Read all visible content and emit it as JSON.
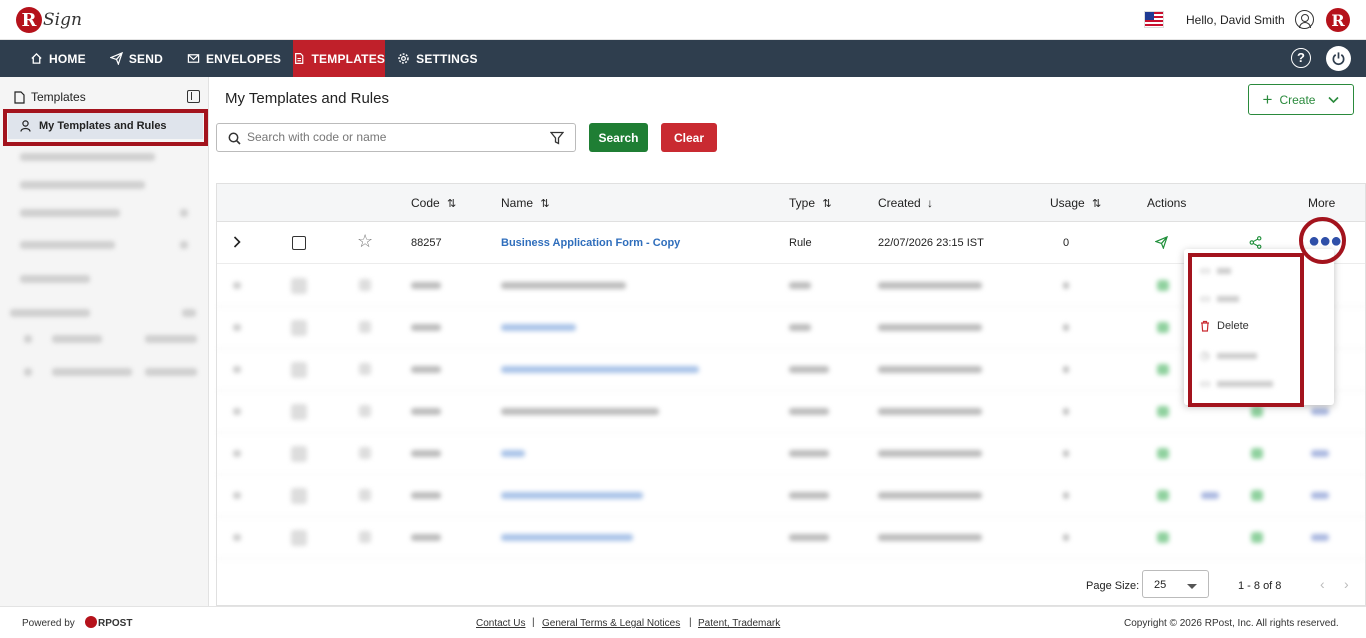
{
  "app": {
    "logo_letter": "R",
    "logo_text": "Sign"
  },
  "header": {
    "greeting": "Hello, David Smith",
    "avatar_letter": "R"
  },
  "nav": {
    "items": [
      {
        "label": "HOME",
        "icon": "home-icon"
      },
      {
        "label": "SEND",
        "icon": "send-icon"
      },
      {
        "label": "ENVELOPES",
        "icon": "envelope-icon"
      },
      {
        "label": "TEMPLATES",
        "icon": "template-icon",
        "active": true
      },
      {
        "label": "SETTINGS",
        "icon": "gear-icon"
      }
    ],
    "help": "?"
  },
  "sidebar": {
    "heading": "Templates",
    "active_item": "My Templates and Rules"
  },
  "main": {
    "title": "My Templates and Rules",
    "create_label": "Create",
    "search": {
      "placeholder": "Search with code or name",
      "button": "Search",
      "clear": "Clear"
    }
  },
  "table": {
    "columns": {
      "code": "Code",
      "name": "Name",
      "type": "Type",
      "created": "Created",
      "usage": "Usage",
      "actions": "Actions",
      "more": "More"
    },
    "first_row": {
      "code": "88257",
      "name": "Business Application Form - Copy",
      "type": "Rule",
      "created": "22/07/2026 23:15 IST",
      "usage": "0"
    }
  },
  "more_menu": {
    "visible_item": "Delete"
  },
  "pager": {
    "page_size_label": "Page Size:",
    "page_size": "25",
    "range": "1 - 8 of 8"
  },
  "footer": {
    "powered_by": "Powered by",
    "brand": "RPOST",
    "links": [
      "Contact Us",
      "General Terms & Legal Notices",
      "Patent, Trademark"
    ],
    "copyright": "Copyright © 2026 RPost, Inc. All rights reserved."
  },
  "colors": {
    "nav_bg": "#2f3e4e",
    "active_tab": "#c0202a",
    "primary_green": "#1f7e34",
    "danger_red": "#c92a31",
    "link_blue": "#2f6ebc",
    "annotation_red": "#a3131d"
  }
}
